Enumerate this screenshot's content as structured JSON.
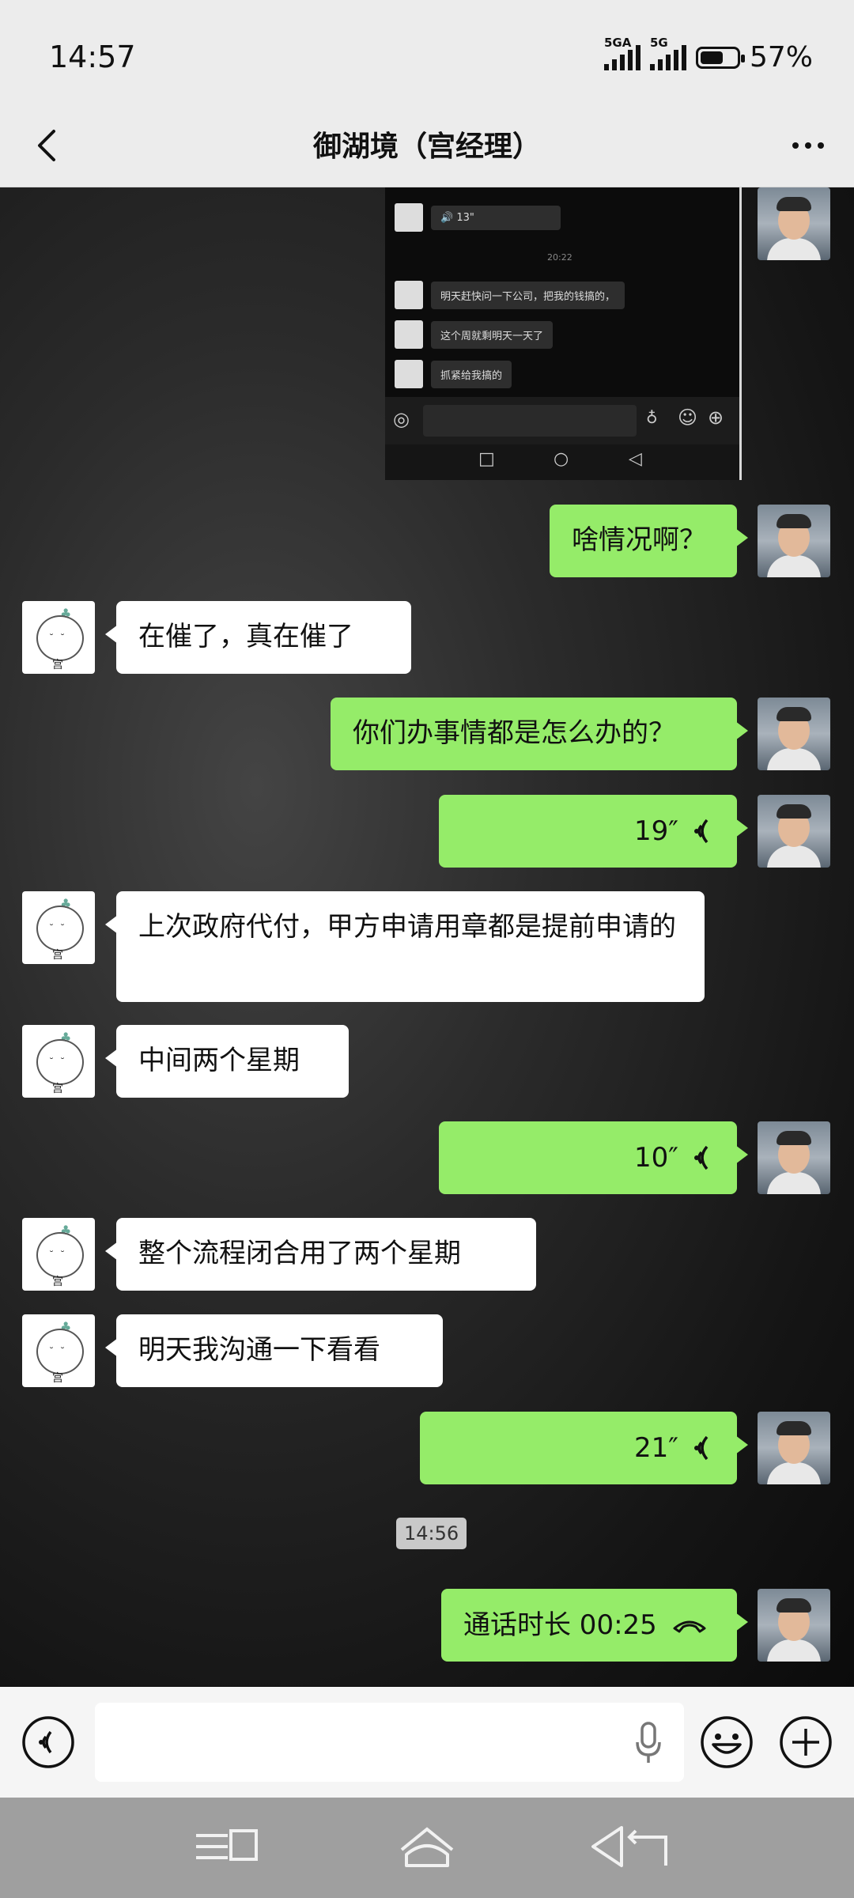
{
  "status": {
    "time": "14:57",
    "sig1": "5GA",
    "sig2": "5G",
    "battery": "57%"
  },
  "header": {
    "title": "御湖境（宫经理）"
  },
  "embedded": {
    "voice": "13\"",
    "time": "20:22",
    "msg1": "明天赶快问一下公司，把我的钱搞的，",
    "msg2": "这个周就剩明天一天了",
    "msg3": "抓紧给我搞的"
  },
  "messages": {
    "m1": "啥情况啊？",
    "m2": "在催了，真在催了",
    "m3": "你们办事情都是怎么办的？",
    "m4": "19″",
    "m5": "上次政府代付，甲方申请用章都是提前申请的",
    "m6": "中间两个星期",
    "m7": "10″",
    "m8": "整个流程闭合用了两个星期",
    "m9": "明天我沟通一下看看",
    "m10": "21″",
    "time": "14:56",
    "m11": "通话时长 00:25"
  },
  "avatar_other_char": "宫"
}
